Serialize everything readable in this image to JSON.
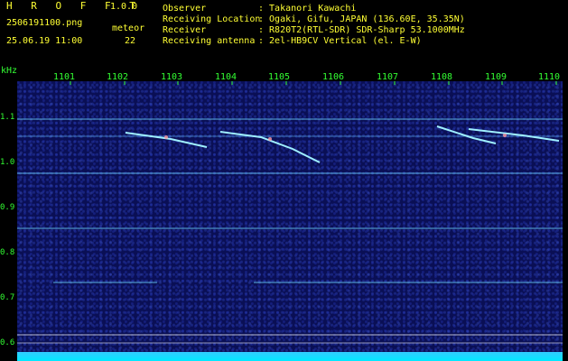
{
  "header": {
    "app_title": "H R O F F T",
    "version": "1.0.0",
    "filename": "2506191100.png",
    "datetime": "25.06.19 11:00",
    "meteor_label": "meteor",
    "meteor_count": "22"
  },
  "info": [
    {
      "label": "Observer",
      "value": ": Takanori Kawachi"
    },
    {
      "label": "Receiving Location",
      "value": ": Ogaki, Gifu, JAPAN (136.60E, 35.35N)"
    },
    {
      "label": "Receiver",
      "value": ": R820T2(RTL-SDR) SDR-Sharp 53.1000MHz"
    },
    {
      "label": "Receiving antenna",
      "value": ": 2el-HB9CV Vertical (el. E-W)"
    }
  ],
  "axis": {
    "y_unit": "kHz",
    "x_ticks": [
      "1101",
      "1102",
      "1103",
      "1104",
      "1105",
      "1106",
      "1107",
      "1108",
      "1109",
      "1110"
    ],
    "y_ticks": [
      "1.1",
      "1.0",
      "0.9",
      "0.8",
      "0.7",
      "0.6"
    ]
  },
  "colors": {
    "header_yellow": "#ffff33",
    "axis_green": "#33ff33",
    "background": "#0a0f55",
    "signal": "#8fe8ff"
  }
}
